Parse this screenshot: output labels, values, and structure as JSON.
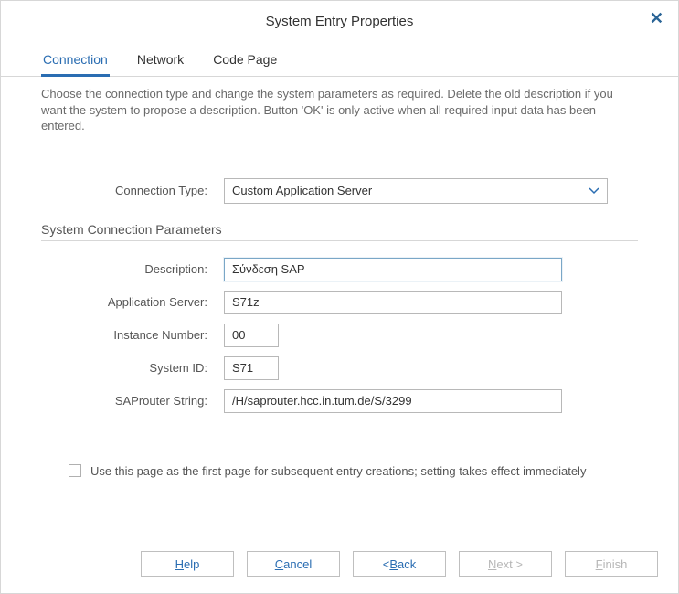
{
  "dialog": {
    "title": "System Entry Properties"
  },
  "tabs": {
    "connection": "Connection",
    "network": "Network",
    "code_page": "Code Page"
  },
  "help_text": "Choose the connection type and change the system parameters as required. Delete the old description if you want the system to propose a description. Button 'OK' is only active when all required input data has been entered.",
  "form": {
    "connection_type_label": "Connection Type:",
    "connection_type_value": "Custom Application Server",
    "section_title": "System Connection Parameters",
    "description_label": "Description:",
    "description_value": "Σύνδεση SAP",
    "appserver_label": "Application Server:",
    "appserver_value": "S71z",
    "instno_label": "Instance Number:",
    "instno_value": "00",
    "sysid_label": "System ID:",
    "sysid_value": "S71",
    "router_label": "SAProuter String:",
    "router_value": "/H/saprouter.hcc.in.tum.de/S/3299"
  },
  "checkbox": {
    "label": "Use this page as the first page for subsequent entry creations; setting takes effect immediately",
    "checked": false
  },
  "buttons": {
    "help_pre": "",
    "help_m": "H",
    "help_post": "elp",
    "cancel_pre": "",
    "cancel_m": "C",
    "cancel_post": "ancel",
    "back_pre": "< ",
    "back_m": "B",
    "back_post": "ack",
    "next_pre": "",
    "next_m": "N",
    "next_post": "ext >",
    "finish_pre": "",
    "finish_m": "F",
    "finish_post": "inish"
  }
}
